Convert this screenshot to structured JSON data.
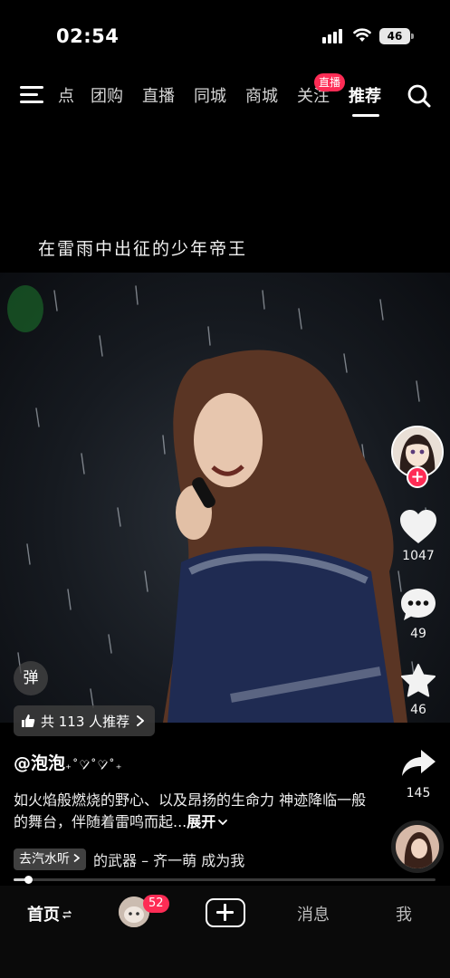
{
  "status_bar": {
    "time": "02:54",
    "battery": "46"
  },
  "top_nav": {
    "tabs": [
      "点",
      "团购",
      "直播",
      "同城",
      "商城",
      "关注",
      "推荐"
    ],
    "active_tab": "推荐",
    "live_badge": "直播"
  },
  "video": {
    "caption": "在雷雨中出征的少年帝王",
    "danmaku_label": "弹",
    "recommend_text": "共 113 人推荐"
  },
  "actions": {
    "likes": "1047",
    "comments": "49",
    "favorites": "46",
    "shares": "145",
    "follow_label": "+"
  },
  "info": {
    "author": "@泡泡",
    "author_deco": "₊˚♡̷̷̷˚♡̷̷̷˚₊",
    "description": "如火焰般燃烧的野心、以及昂扬的生命力 神迹降临一般的舞台，伴随着雷鸣而起...",
    "expand_label": "展开",
    "music_tag": "去汽水听",
    "music_title": "的武器 – 齐一萌   成为我"
  },
  "progress": {
    "played_fraction": 0.035
  },
  "bottom_nav": {
    "home": "首页",
    "friends_badge": "52",
    "messages": "消息",
    "me": "我"
  },
  "colors": {
    "accent": "#fe2c55",
    "background": "#000000"
  }
}
